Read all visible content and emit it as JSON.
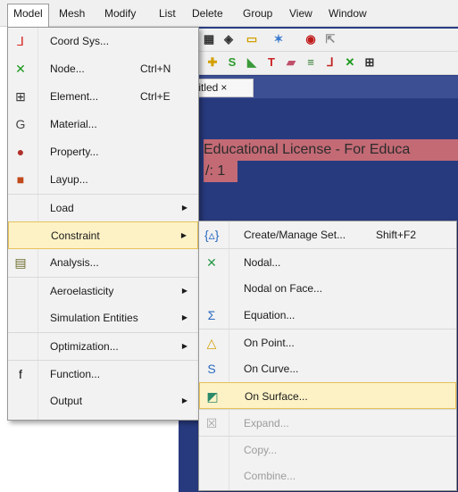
{
  "menubar": {
    "items": [
      "Model",
      "Mesh",
      "Modify",
      "List",
      "Delete",
      "Group",
      "View",
      "Window"
    ]
  },
  "app": {
    "tab_title": "titled",
    "tab_close": "×",
    "license_banner": "Educational License - For Educa",
    "version_banner": "/: 1"
  },
  "model_menu": {
    "items": [
      {
        "label": "Coord Sys...",
        "shortcut": "",
        "icon": "coord-sys-icon",
        "glyph": "⅃",
        "color": "#d62020"
      },
      {
        "label": "Node...",
        "shortcut": "Ctrl+N",
        "icon": "node-icon",
        "glyph": "✕",
        "color": "#1a9a1a"
      },
      {
        "label": "Element...",
        "shortcut": "Ctrl+E",
        "icon": "element-icon",
        "glyph": "⊞",
        "color": "#333333"
      },
      {
        "label": "Material...",
        "shortcut": "",
        "icon": "material-icon",
        "glyph": "G",
        "color": "#444444"
      },
      {
        "label": "Property...",
        "shortcut": "",
        "icon": "property-icon",
        "glyph": "●",
        "color": "#b0302a"
      },
      {
        "label": "Layup...",
        "shortcut": "",
        "icon": "layup-icon",
        "glyph": "■",
        "color": "#c04a1c"
      },
      {
        "label": "Load",
        "shortcut": "",
        "icon": "",
        "glyph": "",
        "color": "#000000",
        "submenu": true
      },
      {
        "label": "Constraint",
        "shortcut": "",
        "icon": "",
        "glyph": "",
        "color": "#000000",
        "submenu": true
      },
      {
        "label": "Analysis...",
        "shortcut": "",
        "icon": "analysis-icon",
        "glyph": "▤",
        "color": "#6b6b2a"
      },
      {
        "label": "Aeroelasticity",
        "shortcut": "",
        "icon": "",
        "glyph": "",
        "color": "#000000",
        "submenu": true
      },
      {
        "label": "Simulation Entities",
        "shortcut": "",
        "icon": "",
        "glyph": "",
        "color": "#000000",
        "submenu": true
      },
      {
        "label": "Optimization...",
        "shortcut": "",
        "icon": "",
        "glyph": "",
        "color": "#000000",
        "submenu": true
      },
      {
        "label": "Function...",
        "shortcut": "",
        "icon": "function-icon",
        "glyph": "f",
        "color": "#111111"
      },
      {
        "label": "Output",
        "shortcut": "",
        "icon": "",
        "glyph": "",
        "color": "#000000",
        "submenu": true
      }
    ]
  },
  "constraint_menu": {
    "items": [
      {
        "label": "Create/Manage Set...",
        "shortcut": "Shift+F2",
        "icon": "set-icon",
        "glyph": "{▵}",
        "enabled": true
      },
      {
        "label": "Nodal...",
        "shortcut": "",
        "icon": "nodal-constraint-icon",
        "glyph": "✕",
        "enabled": true
      },
      {
        "label": "Nodal on Face...",
        "shortcut": "",
        "icon": "",
        "glyph": "",
        "enabled": true
      },
      {
        "label": "Equation...",
        "shortcut": "",
        "icon": "equation-icon",
        "glyph": "Σ",
        "enabled": true
      },
      {
        "label": "On Point...",
        "shortcut": "",
        "icon": "on-point-icon",
        "glyph": "△",
        "enabled": true
      },
      {
        "label": "On Curve...",
        "shortcut": "",
        "icon": "on-curve-icon",
        "glyph": "S",
        "enabled": true
      },
      {
        "label": "On Surface...",
        "shortcut": "",
        "icon": "on-surface-icon",
        "glyph": "◩",
        "enabled": true
      },
      {
        "label": "Expand...",
        "shortcut": "",
        "icon": "expand-icon",
        "glyph": "☒",
        "enabled": false
      },
      {
        "label": "Copy...",
        "shortcut": "",
        "icon": "",
        "glyph": "",
        "enabled": false
      },
      {
        "label": "Combine...",
        "shortcut": "",
        "icon": "",
        "glyph": "",
        "enabled": false
      }
    ]
  },
  "colors": {
    "highlight_bg": "#fdf2c6",
    "highlight_border": "#e6c25a",
    "viewport": "#283a7e",
    "license_banner": "#c36a75"
  }
}
